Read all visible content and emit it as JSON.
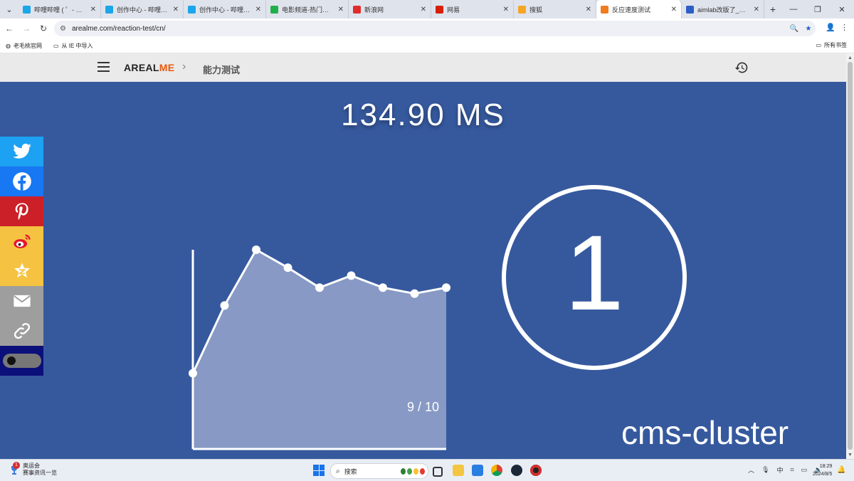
{
  "browser": {
    "tabs": [
      {
        "label": "哔哩哔哩 ( ゜- ゜)つロ",
        "favicon": "bilibili-icon",
        "color": "#1aa6e8",
        "active": false
      },
      {
        "label": "创作中心 - 哔哩哔哩",
        "favicon": "bilibili-icon",
        "color": "#1aa6e8",
        "active": false
      },
      {
        "label": "创作中心 - 哔哩哔哩",
        "favicon": "bilibili-icon",
        "color": "#1aa6e8",
        "active": false
      },
      {
        "label": "电影频道-热门好看电",
        "favicon": "play-icon",
        "color": "#1fb04b",
        "active": false
      },
      {
        "label": "新浪网",
        "favicon": "weibo-eye-icon",
        "color": "#e22b2b",
        "active": false
      },
      {
        "label": "网易",
        "favicon": "netease-icon",
        "color": "#d81e06",
        "active": false
      },
      {
        "label": "搜狐",
        "favicon": "sohu-icon",
        "color": "#f5a623",
        "active": false
      },
      {
        "label": "反应速度测试",
        "favicon": "fox-icon",
        "color": "#ef7c1f",
        "active": true
      },
      {
        "label": "aimlab改版了_百度搜",
        "favicon": "baidu-icon",
        "color": "#2b5ec4",
        "active": false
      }
    ],
    "url": "arealme.com/reaction-test/cn/",
    "bookmarks": [
      {
        "label": "老毛桃官网",
        "icon": "globe-icon"
      },
      {
        "label": "从 IE 中导入",
        "icon": "folder-icon"
      }
    ],
    "all_bookmarks": "所有书签"
  },
  "site": {
    "brand_main": "AREAL",
    "brand_accent": "ME",
    "breadcrumb": "能力测试",
    "accent_color": "#e8590c",
    "background_color": "#36599e"
  },
  "test": {
    "result_text": "134.90 MS",
    "counter": "1",
    "progress_text": "9 / 10",
    "watermark": "cms-cluster"
  },
  "chart_data": {
    "type": "area",
    "title": "",
    "xlabel": "",
    "ylabel": "",
    "x": [
      1,
      2,
      3,
      4,
      5,
      6,
      7,
      8,
      9
    ],
    "values": [
      0.38,
      0.72,
      1.0,
      0.91,
      0.81,
      0.87,
      0.81,
      0.78,
      0.81
    ],
    "ylim": [
      0,
      1
    ],
    "grid": false,
    "fill_color": "#8799c4",
    "line_color": "#ffffff"
  },
  "share": [
    {
      "name": "twitter-icon",
      "color": "#1da1f2"
    },
    {
      "name": "facebook-icon",
      "color": "#1877f2"
    },
    {
      "name": "pinterest-icon",
      "color": "#cb2027"
    },
    {
      "name": "weibo-icon",
      "color": "#f5c341"
    },
    {
      "name": "qzone-icon",
      "color": "#f5c341"
    },
    {
      "name": "email-icon",
      "color": "#9e9e9e"
    },
    {
      "name": "link-icon",
      "color": "#9e9e9e"
    }
  ],
  "taskbar": {
    "weather_title": "奥运会",
    "weather_subtitle": "赛事资讯一览",
    "weather_badge": "1",
    "search_placeholder": "搜索",
    "ime": "中",
    "time": "18:29",
    "date": "2024/8/5"
  }
}
